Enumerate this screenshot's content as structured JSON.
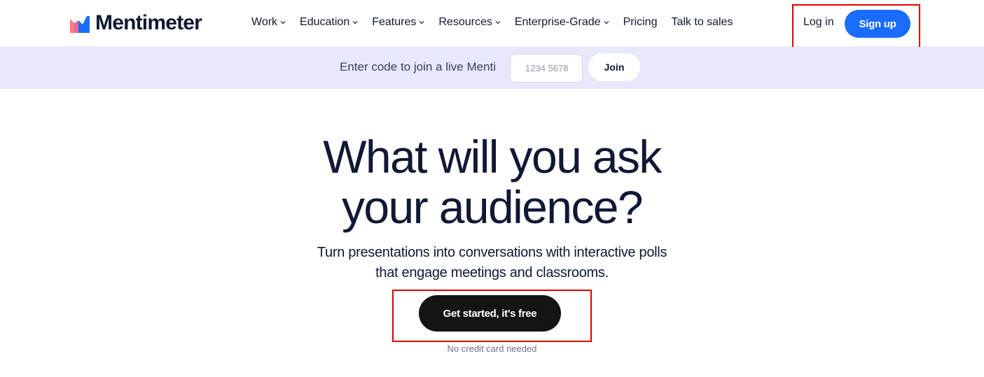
{
  "brand": {
    "name": "Mentimeter",
    "accent": "#196cff",
    "logo_colors": [
      "#ff7b7b",
      "#196cff",
      "#6f5bff"
    ]
  },
  "nav": {
    "items": [
      {
        "label": "Work",
        "dropdown": true
      },
      {
        "label": "Education",
        "dropdown": true
      },
      {
        "label": "Features",
        "dropdown": true
      },
      {
        "label": "Resources",
        "dropdown": true
      },
      {
        "label": "Enterprise-Grade",
        "dropdown": true
      },
      {
        "label": "Pricing",
        "dropdown": false
      },
      {
        "label": "Talk to sales",
        "dropdown": false
      }
    ],
    "login_label": "Log in",
    "signup_label": "Sign up"
  },
  "code_bar": {
    "label": "Enter code to join a live Menti",
    "input_placeholder": "1234 5678",
    "join_label": "Join",
    "background": "#e7e8fa"
  },
  "hero": {
    "title_line1": "What will you ask",
    "title_line2": "your audience?",
    "subtitle_line1": "Turn presentations into conversations with interactive polls",
    "subtitle_line2": "that engage meetings and classrooms.",
    "cta_label": "Get started, it's free",
    "cta_note": "No credit card needed"
  },
  "highlight_color": "#e00000"
}
